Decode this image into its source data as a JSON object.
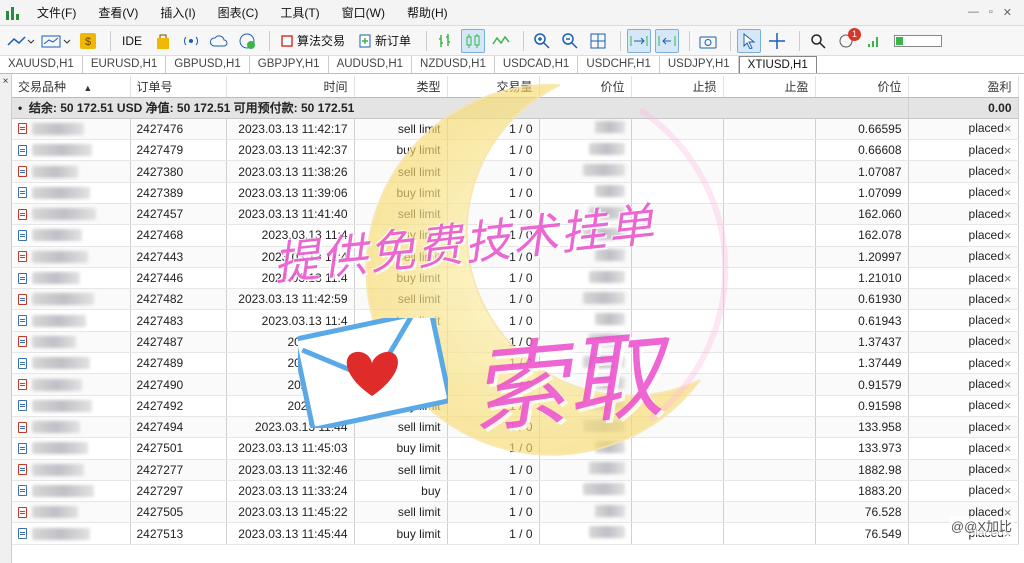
{
  "menu": [
    "文件(F)",
    "查看(V)",
    "插入(I)",
    "图表(C)",
    "工具(T)",
    "窗口(W)",
    "帮助(H)"
  ],
  "window_controls": [
    "—",
    "▫",
    "✕"
  ],
  "toolbar": {
    "ide_label": "IDE",
    "algo_trading_label": "算法交易",
    "new_order_label": "新订单",
    "notification_count": "1",
    "signal_level": 0.15
  },
  "chart_tabs": [
    "XAUUSD,H1",
    "EURUSD,H1",
    "GBPUSD,H1",
    "GBPJPY,H1",
    "AUDUSD,H1",
    "NZDUSD,H1",
    "USDCAD,H1",
    "USDCHF,H1",
    "USDJPY,H1",
    "XTIUSD,H1"
  ],
  "active_chart_tab": "XTIUSD,H1",
  "side_strip_close": "×",
  "columns": [
    "交易品种",
    "订单号",
    "时间",
    "类型",
    "交易量",
    "价位",
    "止损",
    "止盈",
    "价位",
    "盈利"
  ],
  "sort_indicator": "▲",
  "balance_row": {
    "bullet": "•",
    "text": "结余: 50 172.51 USD  净值: 50 172.51  可用预付款: 50 172.51",
    "profit": "0.00"
  },
  "orders": [
    {
      "ticket": "2427476",
      "time": "2023.03.13 11:42:17",
      "type": "sell limit",
      "volume": "1 / 0",
      "price": "0.66595",
      "status": "placed"
    },
    {
      "ticket": "2427479",
      "time": "2023.03.13 11:42:37",
      "type": "buy limit",
      "volume": "1 / 0",
      "price": "0.66608",
      "status": "placed"
    },
    {
      "ticket": "2427380",
      "time": "2023.03.13 11:38:26",
      "type": "sell limit",
      "volume": "1 / 0",
      "price": "1.07087",
      "status": "placed"
    },
    {
      "ticket": "2427389",
      "time": "2023.03.13 11:39:06",
      "type": "buy limit",
      "volume": "1 / 0",
      "price": "1.07099",
      "status": "placed"
    },
    {
      "ticket": "2427457",
      "time": "2023.03.13 11:41:40",
      "type": "sell limit",
      "volume": "1 / 0",
      "price": "162.060",
      "status": "placed"
    },
    {
      "ticket": "2427468",
      "time": "2023.03.13 11:4",
      "type": "buy limit",
      "volume": "1 / 0",
      "price": "162.078",
      "status": "placed"
    },
    {
      "ticket": "2427443",
      "time": "2023.03.13 11:4",
      "type": "sell limit",
      "volume": "1 / 0",
      "price": "1.20997",
      "status": "placed"
    },
    {
      "ticket": "2427446",
      "time": "2023.03.13 11:4",
      "type": "buy limit",
      "volume": "1 / 0",
      "price": "1.21010",
      "status": "placed"
    },
    {
      "ticket": "2427482",
      "time": "2023.03.13 11:42:59",
      "type": "sell limit",
      "volume": "1 / 0",
      "price": "0.61930",
      "status": "placed"
    },
    {
      "ticket": "2427483",
      "time": "2023.03.13 11:4",
      "type": "buy limit",
      "volume": "1 / 0",
      "price": "0.61943",
      "status": "placed"
    },
    {
      "ticket": "2427487",
      "time": "2023.03.13",
      "type": "sell limit",
      "volume": "1 / 0",
      "price": "1.37437",
      "status": "placed"
    },
    {
      "ticket": "2427489",
      "time": "2023.03.13",
      "type": "buy limit",
      "volume": "1 / 0",
      "price": "1.37449",
      "status": "placed"
    },
    {
      "ticket": "2427490",
      "time": "2023.03.13",
      "type": "sell limit",
      "volume": "1 / 0",
      "price": "0.91579",
      "status": "placed"
    },
    {
      "ticket": "2427492",
      "time": "2023.03.13",
      "type": "buy limit",
      "volume": "1 / 0",
      "price": "0.91598",
      "status": "placed"
    },
    {
      "ticket": "2427494",
      "time": "2023.03.13 11:44",
      "type": "sell limit",
      "volume": "1 / 0",
      "price": "133.958",
      "status": "placed"
    },
    {
      "ticket": "2427501",
      "time": "2023.03.13 11:45:03",
      "type": "buy limit",
      "volume": "1 / 0",
      "price": "133.973",
      "status": "placed"
    },
    {
      "ticket": "2427277",
      "time": "2023.03.13 11:32:46",
      "type": "sell limit",
      "volume": "1 / 0",
      "price": "1882.98",
      "status": "placed"
    },
    {
      "ticket": "2427297",
      "time": "2023.03.13 11:33:24",
      "type": "buy",
      "volume": "1 / 0",
      "price": "1883.20",
      "status": "placed"
    },
    {
      "ticket": "2427505",
      "time": "2023.03.13 11:45:22",
      "type": "sell limit",
      "volume": "1 / 0",
      "price": "76.528",
      "status": "placed"
    },
    {
      "ticket": "2427513",
      "time": "2023.03.13 11:45:44",
      "type": "buy limit",
      "volume": "1 / 0",
      "price": "76.549",
      "status": "placed"
    }
  ],
  "row_close": "×",
  "watermark": {
    "line1": "提供免费技术挂单",
    "line2": "索取",
    "handle": "@@X加比"
  },
  "colors": {
    "accent_blue": "#1a5fb4",
    "watermark_pink": "#e646c8",
    "moon_yellow": "#f7e89a",
    "sell_icon": "#c0392b",
    "buy_icon": "#3a6fb0"
  }
}
